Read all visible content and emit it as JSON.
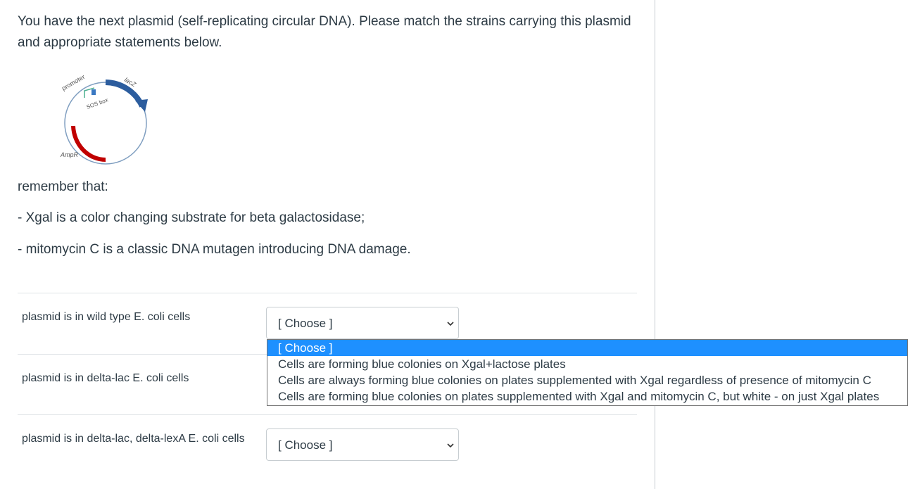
{
  "question": {
    "intro": "You have the next plasmid (self-replicating circular DNA). Please match the strains carrying this plasmid and appropriate statements below.",
    "diagram_labels": {
      "promoter": "promoter",
      "lacz": "lacZ",
      "sos": "SOS box",
      "ampr": "AmpR"
    },
    "remember": "remember that:",
    "note1": "- Xgal is a color changing substrate for beta galactosidase;",
    "note2": "- mitomycin C is a classic DNA mutagen introducing DNA damage."
  },
  "rows": [
    {
      "label": "plasmid is in wild type E. coli cells",
      "selected": "[ Choose ]"
    },
    {
      "label": "plasmid is in delta-lac E. coli cells",
      "selected": "[ Choose ]"
    },
    {
      "label": "plasmid is in delta-lac, delta-lexA E. coli cells",
      "selected": "[ Choose ]"
    }
  ],
  "dropdown_options": [
    "[ Choose ]",
    "Cells are forming blue colonies on Xgal+lactose plates",
    "Cells are always forming blue colonies on plates supplemented with Xgal regardless of presence of mitomycin C",
    "Cells are forming blue colonies on plates supplemented with Xgal and mitomycin C, but white - on just Xgal plates"
  ],
  "colors": {
    "highlight": "#1e90ff",
    "lacz": "#2c5d9e",
    "ampr": "#c00000",
    "promoter": "#4caf8f"
  }
}
